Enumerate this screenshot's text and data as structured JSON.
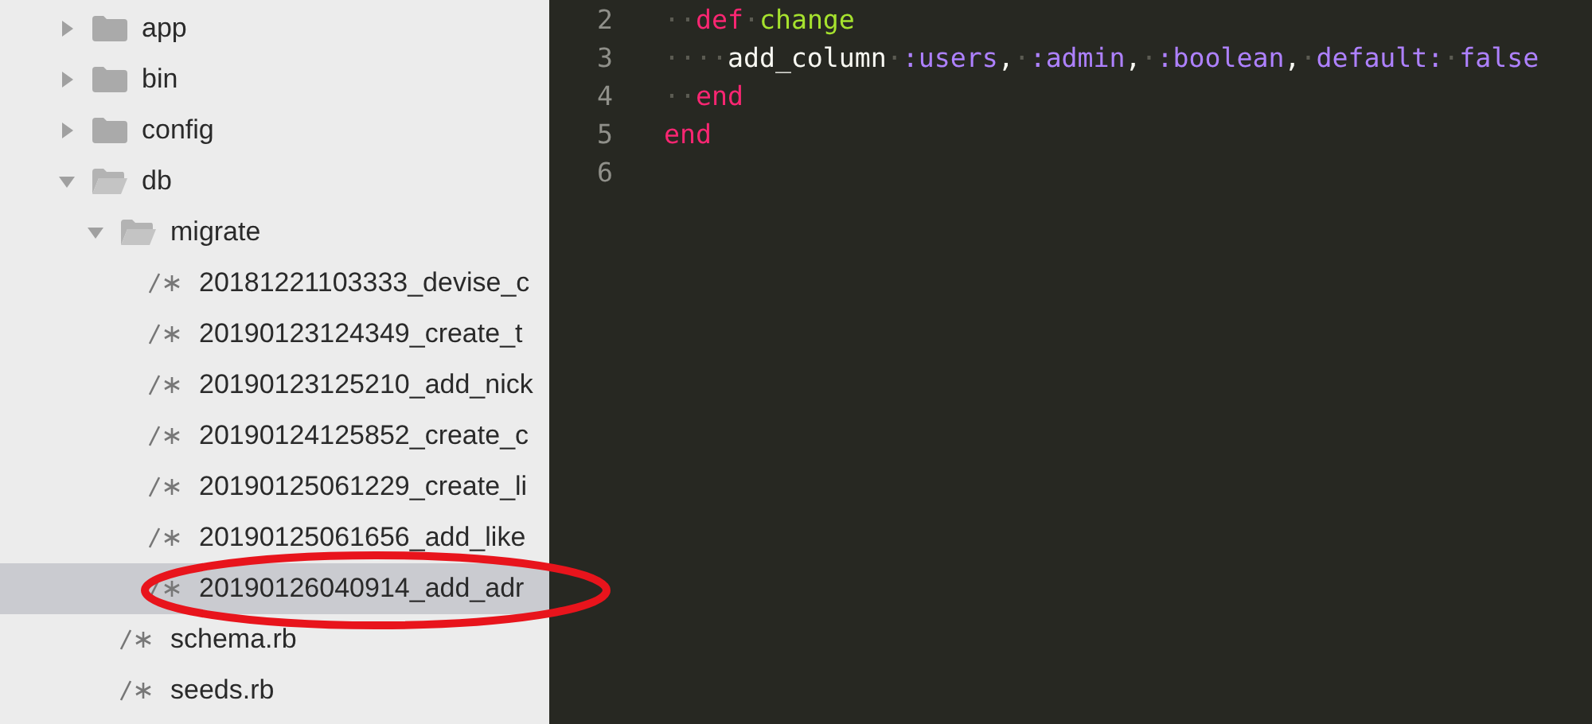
{
  "sidebar": {
    "tree": [
      {
        "kind": "folder",
        "name": "app",
        "expanded": false,
        "selected": false
      },
      {
        "kind": "folder",
        "name": "bin",
        "expanded": false,
        "selected": false
      },
      {
        "kind": "folder",
        "name": "config",
        "expanded": false,
        "selected": false
      },
      {
        "kind": "folder",
        "name": "db",
        "expanded": true,
        "selected": false,
        "children": [
          {
            "kind": "folder",
            "name": "migrate",
            "expanded": true,
            "selected": false,
            "children": [
              {
                "kind": "file",
                "name": "20181221103333_devise_c",
                "selected": false
              },
              {
                "kind": "file",
                "name": "20190123124349_create_t",
                "selected": false
              },
              {
                "kind": "file",
                "name": "20190123125210_add_nick",
                "selected": false
              },
              {
                "kind": "file",
                "name": "20190124125852_create_c",
                "selected": false
              },
              {
                "kind": "file",
                "name": "20190125061229_create_li",
                "selected": false
              },
              {
                "kind": "file",
                "name": "20190125061656_add_like",
                "selected": false
              },
              {
                "kind": "file",
                "name": "20190126040914_add_adr",
                "selected": true
              }
            ]
          },
          {
            "kind": "file",
            "name": "schema.rb",
            "selected": false
          },
          {
            "kind": "file",
            "name": "seeds.rb",
            "selected": false
          }
        ]
      }
    ]
  },
  "editor": {
    "lines": [
      {
        "number": "2",
        "tokens": [
          {
            "kind": "space",
            "text": "··"
          },
          {
            "kind": "keyword",
            "text": "def"
          },
          {
            "kind": "space",
            "text": "·"
          },
          {
            "kind": "method",
            "text": "change"
          }
        ]
      },
      {
        "number": "3",
        "tokens": [
          {
            "kind": "space",
            "text": "····"
          },
          {
            "kind": "plain",
            "text": "add_column"
          },
          {
            "kind": "space",
            "text": "·"
          },
          {
            "kind": "symbol",
            "text": ":users"
          },
          {
            "kind": "plain",
            "text": ","
          },
          {
            "kind": "space",
            "text": "·"
          },
          {
            "kind": "symbol",
            "text": ":admin"
          },
          {
            "kind": "plain",
            "text": ","
          },
          {
            "kind": "space",
            "text": "·"
          },
          {
            "kind": "symbol",
            "text": ":boolean"
          },
          {
            "kind": "plain",
            "text": ","
          },
          {
            "kind": "space",
            "text": "·"
          },
          {
            "kind": "symbol",
            "text": "default:"
          },
          {
            "kind": "space",
            "text": "·"
          },
          {
            "kind": "symbol",
            "text": "false"
          }
        ]
      },
      {
        "number": "4",
        "tokens": [
          {
            "kind": "space",
            "text": "··"
          },
          {
            "kind": "keyword",
            "text": "end"
          }
        ]
      },
      {
        "number": "5",
        "tokens": [
          {
            "kind": "keyword",
            "text": "end"
          }
        ]
      },
      {
        "number": "6"
      }
    ]
  },
  "annotations": [
    {
      "kind": "ellipse"
    }
  ]
}
